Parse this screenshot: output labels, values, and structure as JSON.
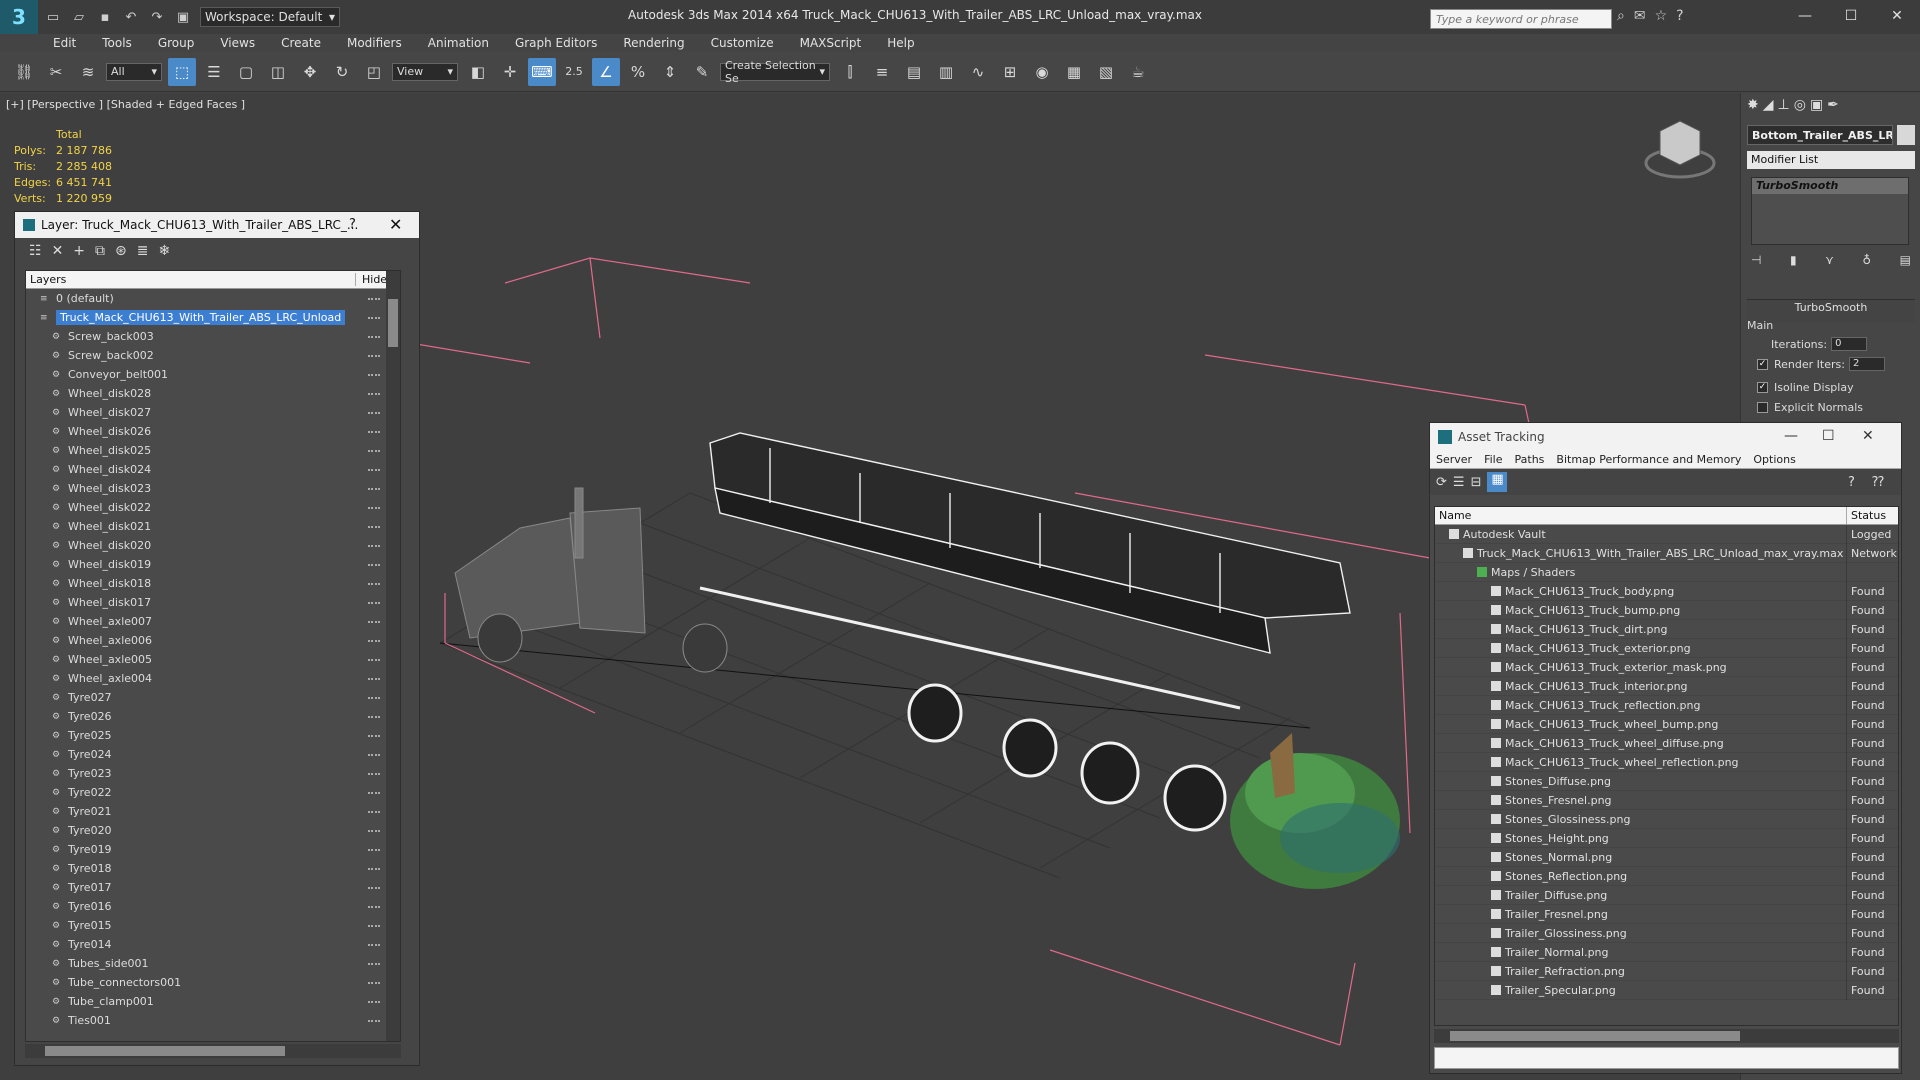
{
  "titlebar": {
    "app_logo": "3",
    "workspace": "Workspace: Default",
    "title": "Autodesk 3ds Max  2014 x64      Truck_Mack_CHU613_With_Trailer_ABS_LRC_Unload_max_vray.max",
    "search_placeholder": "Type a keyword or phrase"
  },
  "menu": [
    "Edit",
    "Tools",
    "Group",
    "Views",
    "Create",
    "Modifiers",
    "Animation",
    "Graph Editors",
    "Rendering",
    "Customize",
    "MAXScript",
    "Help"
  ],
  "toolbar": {
    "selection_filter": "All",
    "reference_coord": "View",
    "snap_value": "2.5",
    "named_selection": "Create Selection Se"
  },
  "viewport": {
    "label": "[+] [Perspective ] [Shaded + Edged Faces ]",
    "stats": {
      "total_label": "Total",
      "polys_label": "Polys:",
      "polys": "2 187 786",
      "tris_label": "Tris:",
      "tris": "2 285 408",
      "edges_label": "Edges:",
      "edges": "6 451 741",
      "verts_label": "Verts:",
      "verts": "1 220 959"
    }
  },
  "layer_panel": {
    "title": "Layer: Truck_Mack_CHU613_With_Trailer_ABS_LRC_...",
    "help": "?",
    "close": "✕",
    "col_layers": "Layers",
    "col_hide": "Hide",
    "rows": [
      "0 (default)",
      "Truck_Mack_CHU613_With_Trailer_ABS_LRC_Unload",
      "Screw_back003",
      "Screw_back002",
      "Conveyor_belt001",
      "Wheel_disk028",
      "Wheel_disk027",
      "Wheel_disk026",
      "Wheel_disk025",
      "Wheel_disk024",
      "Wheel_disk023",
      "Wheel_disk022",
      "Wheel_disk021",
      "Wheel_disk020",
      "Wheel_disk019",
      "Wheel_disk018",
      "Wheel_disk017",
      "Wheel_axle007",
      "Wheel_axle006",
      "Wheel_axle005",
      "Wheel_axle004",
      "Tyre027",
      "Tyre026",
      "Tyre025",
      "Tyre024",
      "Tyre023",
      "Tyre022",
      "Tyre021",
      "Tyre020",
      "Tyre019",
      "Tyre018",
      "Tyre017",
      "Tyre016",
      "Tyre015",
      "Tyre014",
      "Tubes_side001",
      "Tube_connectors001",
      "Tube_clamp001",
      "Ties001"
    ]
  },
  "command_panel": {
    "object_name": "Bottom_Trailer_ABS_LRC",
    "modifier_list": "Modifier List",
    "stack_entry": "TurboSmooth",
    "rollout_title": "TurboSmooth",
    "group_main": "Main",
    "iterations_label": "Iterations:",
    "iterations": "0",
    "render_iters_label": "Render Iters:",
    "render_iters": "2",
    "isoline": "Isoline Display",
    "explicit_normals": "Explicit Normals"
  },
  "asset_tracking": {
    "title": "Asset Tracking",
    "menu": [
      "Server",
      "File",
      "Paths",
      "Bitmap Performance and Memory",
      "Options"
    ],
    "col_name": "Name",
    "col_status": "Status",
    "rows": [
      {
        "name": "Autodesk Vault",
        "status": "Logged",
        "indent": 1
      },
      {
        "name": "Truck_Mack_CHU613_With_Trailer_ABS_LRC_Unload_max_vray.max",
        "status": "Network",
        "indent": 2
      },
      {
        "name": "Maps / Shaders",
        "status": "",
        "indent": 3
      },
      {
        "name": "Mack_CHU613_Truck_body.png",
        "status": "Found",
        "indent": 4
      },
      {
        "name": "Mack_CHU613_Truck_bump.png",
        "status": "Found",
        "indent": 4
      },
      {
        "name": "Mack_CHU613_Truck_dirt.png",
        "status": "Found",
        "indent": 4
      },
      {
        "name": "Mack_CHU613_Truck_exterior.png",
        "status": "Found",
        "indent": 4
      },
      {
        "name": "Mack_CHU613_Truck_exterior_mask.png",
        "status": "Found",
        "indent": 4
      },
      {
        "name": "Mack_CHU613_Truck_interior.png",
        "status": "Found",
        "indent": 4
      },
      {
        "name": "Mack_CHU613_Truck_reflection.png",
        "status": "Found",
        "indent": 4
      },
      {
        "name": "Mack_CHU613_Truck_wheel_bump.png",
        "status": "Found",
        "indent": 4
      },
      {
        "name": "Mack_CHU613_Truck_wheel_diffuse.png",
        "status": "Found",
        "indent": 4
      },
      {
        "name": "Mack_CHU613_Truck_wheel_reflection.png",
        "status": "Found",
        "indent": 4
      },
      {
        "name": "Stones_Diffuse.png",
        "status": "Found",
        "indent": 4
      },
      {
        "name": "Stones_Fresnel.png",
        "status": "Found",
        "indent": 4
      },
      {
        "name": "Stones_Glossiness.png",
        "status": "Found",
        "indent": 4
      },
      {
        "name": "Stones_Height.png",
        "status": "Found",
        "indent": 4
      },
      {
        "name": "Stones_Normal.png",
        "status": "Found",
        "indent": 4
      },
      {
        "name": "Stones_Reflection.png",
        "status": "Found",
        "indent": 4
      },
      {
        "name": "Trailer_Diffuse.png",
        "status": "Found",
        "indent": 4
      },
      {
        "name": "Trailer_Fresnel.png",
        "status": "Found",
        "indent": 4
      },
      {
        "name": "Trailer_Glossiness.png",
        "status": "Found",
        "indent": 4
      },
      {
        "name": "Trailer_Normal.png",
        "status": "Found",
        "indent": 4
      },
      {
        "name": "Trailer_Refraction.png",
        "status": "Found",
        "indent": 4
      },
      {
        "name": "Trailer_Specular.png",
        "status": "Found",
        "indent": 4
      }
    ]
  },
  "colors": {
    "selection": "#3c7ed1",
    "stats_text": "#f2d34a",
    "grid": "#2e2e2e",
    "bounds": "#e06a8a"
  }
}
